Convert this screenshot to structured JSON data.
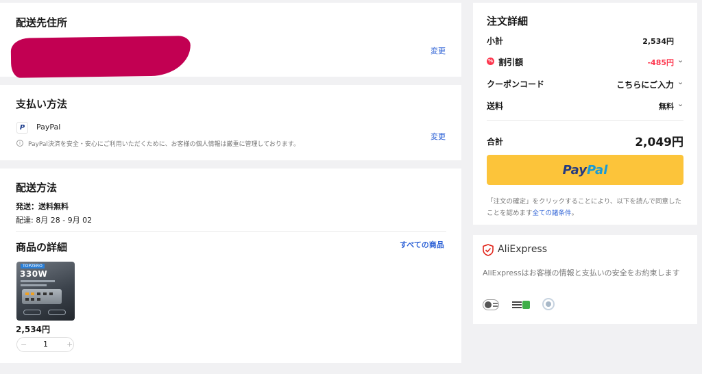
{
  "address": {
    "title": "配送先住所",
    "change_label": "変更"
  },
  "payment": {
    "title": "支払い方法",
    "method": "PayPal",
    "info": "PayPal決済を安全・安心にご利用いただくために、お客様の個人情報は厳重に管理しております。",
    "change_label": "変更"
  },
  "shipping": {
    "title": "配送方法",
    "ship_line": "発送：送料無料",
    "delivery_line": "配達: 8月 28 - 9月 02"
  },
  "product": {
    "title": "商品の詳細",
    "all_items_link": "すべての商品",
    "image_brand": "TOPZERO",
    "image_watt": "330W",
    "price": "2,534円",
    "quantity": "1",
    "minus": "−",
    "plus": "+"
  },
  "order": {
    "title": "注文詳細",
    "subtotal_label": "小計",
    "subtotal_value": "2,534円",
    "discount_label": "割引額",
    "discount_value": "-485円",
    "coupon_label": "クーポンコード",
    "coupon_value": "こちらにご入力",
    "shipping_label": "送料",
    "shipping_value": "無料",
    "total_label": "合計",
    "total_value": "2,049円",
    "paypal_part1": "Pay",
    "paypal_part2": "Pal",
    "terms_text": "「注文の確定」をクリックすることにより、以下を読んで同意したことを認めます",
    "terms_link": "全ての諸条件",
    "terms_end": "。"
  },
  "aliexpress": {
    "brand": "AliExpress",
    "promise": "AliExpressはお客様の情報と支払いの安全をお約束します"
  },
  "colors": {
    "link": "#2e62d6",
    "discount": "#fd384f",
    "paypal_button": "#fcc43a",
    "redaction": "#c20052"
  }
}
